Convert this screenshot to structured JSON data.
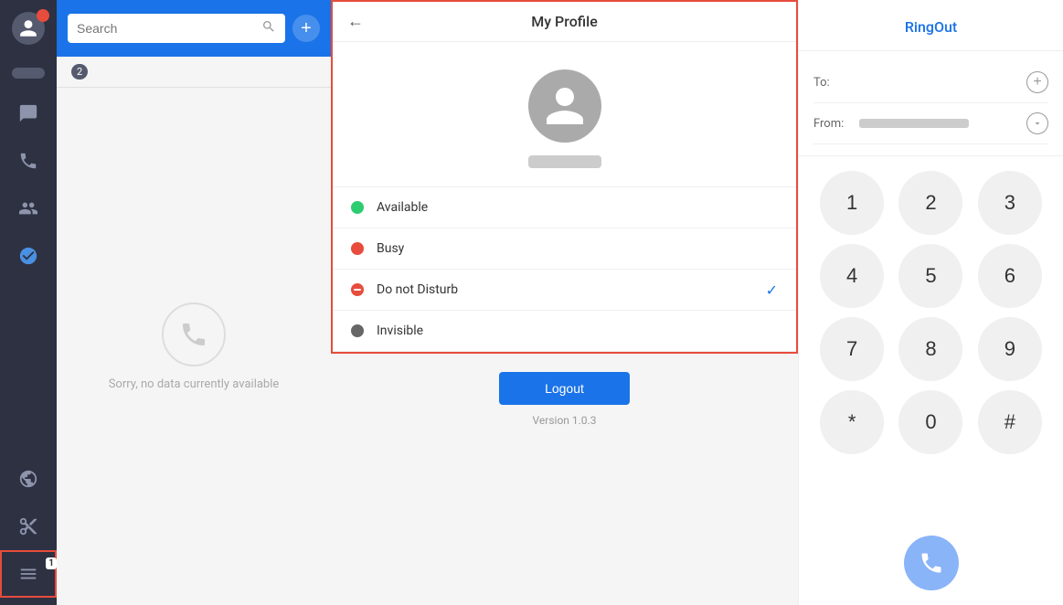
{
  "sidebar": {
    "items": [
      {
        "name": "avatar",
        "icon": "person"
      },
      {
        "name": "messages",
        "icon": "chat"
      },
      {
        "name": "calls",
        "icon": "phone"
      },
      {
        "name": "contacts",
        "icon": "contacts"
      },
      {
        "name": "directory",
        "icon": "directory"
      },
      {
        "name": "apps",
        "icon": "globe"
      },
      {
        "name": "settings",
        "icon": "scissors"
      },
      {
        "name": "menu",
        "icon": "menu",
        "label": "1",
        "active": true
      }
    ]
  },
  "search": {
    "placeholder": "Search",
    "add_label": "+"
  },
  "main_panel": {
    "badge": "2",
    "no_data_text": "Sorry, no data currently available"
  },
  "profile": {
    "title": "My Profile",
    "back_label": "←",
    "status_options": [
      {
        "id": "available",
        "label": "Available",
        "color": "green",
        "selected": false
      },
      {
        "id": "busy",
        "label": "Busy",
        "color": "red",
        "selected": false
      },
      {
        "id": "dnd",
        "label": "Do not Disturb",
        "color": "dnd",
        "selected": true
      },
      {
        "id": "invisible",
        "label": "Invisible",
        "color": "invisible",
        "selected": false
      }
    ],
    "logout_label": "Logout",
    "version_label": "Version 1.0.3"
  },
  "ringout": {
    "title": "RingOut",
    "to_label": "To:",
    "from_label": "From:",
    "to_placeholder": "",
    "dialpad": {
      "keys": [
        "1",
        "2",
        "3",
        "4",
        "5",
        "6",
        "7",
        "8",
        "9",
        "*",
        "0",
        "#"
      ]
    }
  }
}
